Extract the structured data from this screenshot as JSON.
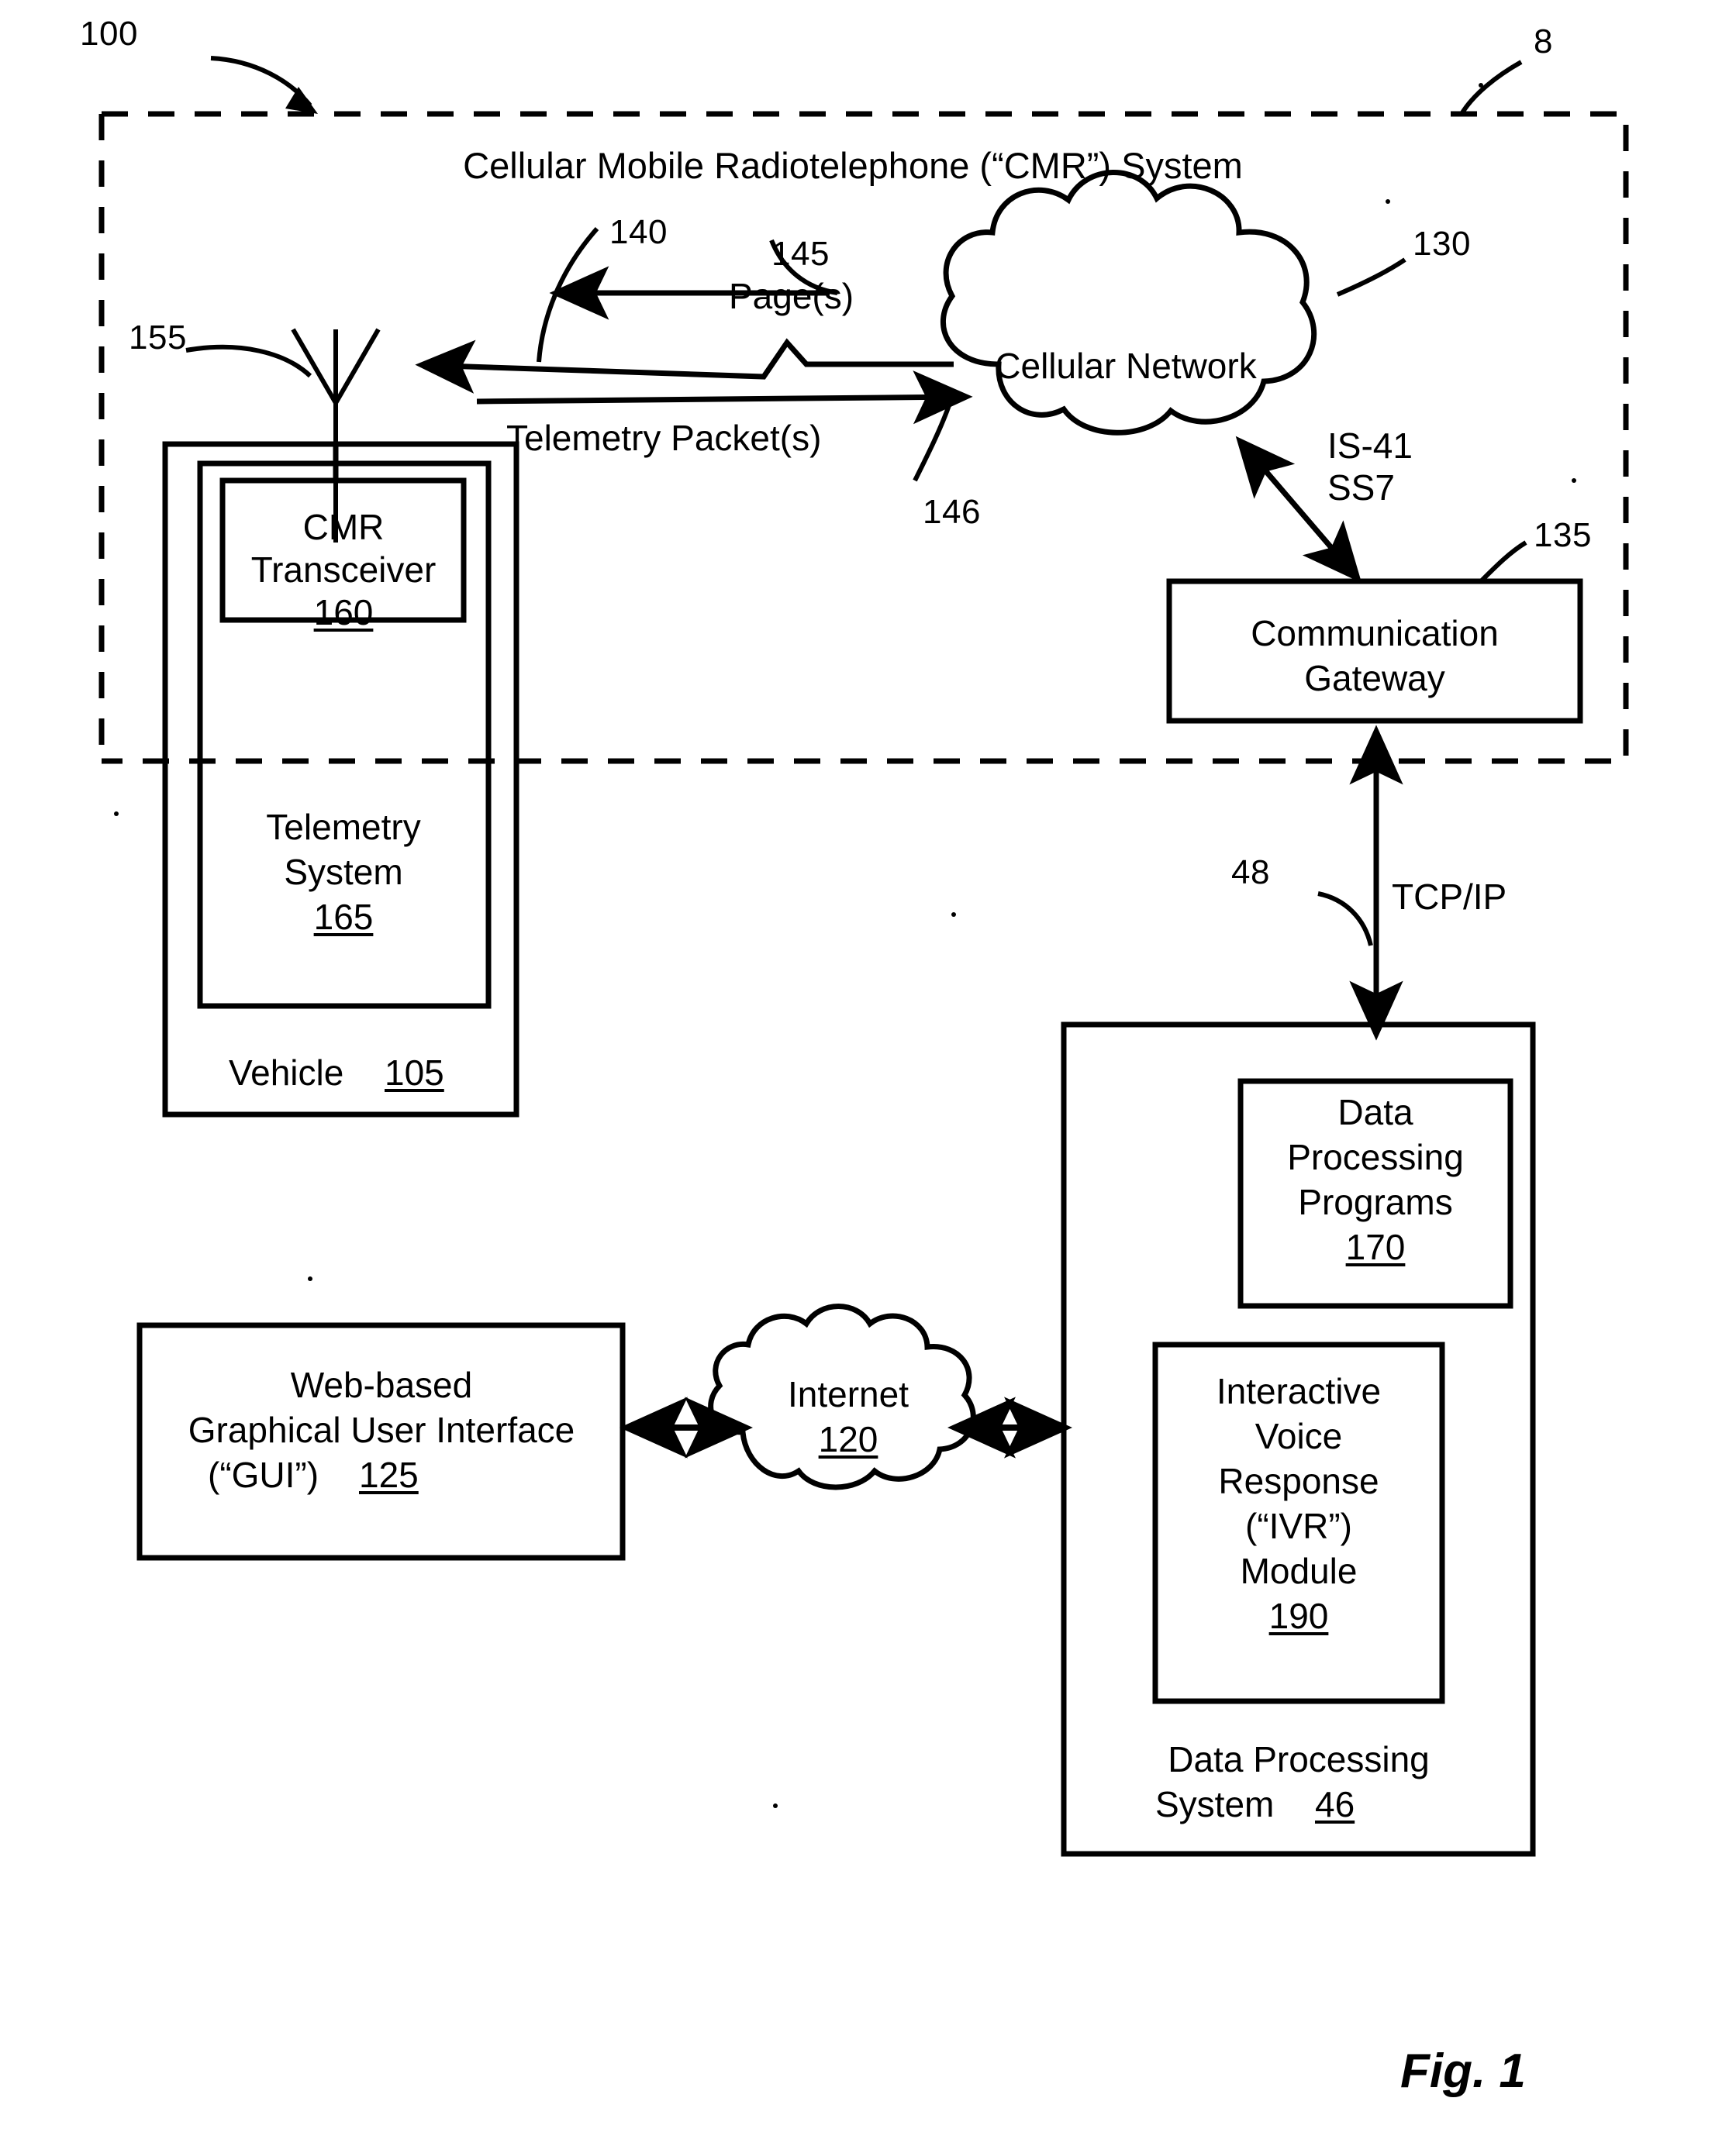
{
  "figure": {
    "caption": "Fig. 1",
    "system_reference": "100",
    "boundary_reference": "8"
  },
  "cmr_system": {
    "title": "Cellular Mobile Radiotelephone (“CMR”) System"
  },
  "nodes": {
    "vehicle": {
      "label": "Vehicle",
      "ref": "105"
    },
    "telemetry_system": {
      "label_line1": "Telemetry",
      "label_line2": "System",
      "ref": "165"
    },
    "cmr_transceiver": {
      "label_line1": "CMR",
      "label_line2": "Transceiver",
      "ref": "160"
    },
    "antenna": {
      "ref": "155"
    },
    "cellular_network": {
      "label": "Cellular Network",
      "ref": "130"
    },
    "communication_gateway": {
      "label_line1": "Communication",
      "label_line2": "Gateway",
      "ref": "135"
    },
    "data_processing_system": {
      "label_line1": "Data Processing",
      "label_line2": "System",
      "ref": "46"
    },
    "data_processing_programs": {
      "label_line1": "Data",
      "label_line2": "Processing",
      "label_line3": "Programs",
      "ref": "170"
    },
    "ivr_module": {
      "label_line1": "Interactive",
      "label_line2": "Voice",
      "label_line3": "Response",
      "label_line4": "(“IVR”)",
      "label_line5": "Module",
      "ref": "190"
    },
    "internet": {
      "label": "Internet",
      "ref": "120"
    },
    "web_gui": {
      "label_line1": "Web-based",
      "label_line2": "Graphical User Interface",
      "label_line3": "(“GUI”)",
      "ref": "125"
    }
  },
  "connections": {
    "downlink": {
      "ref": "140"
    },
    "pages": {
      "label": "Page(s)",
      "ref": "145"
    },
    "telemetry_packets": {
      "label": "Telemetry Packet(s)",
      "ref": "146"
    },
    "is41_ss7": {
      "label_line1": "IS-41",
      "label_line2": "SS7"
    },
    "tcpip": {
      "label": "TCP/IP",
      "ref": "48"
    }
  },
  "style": {
    "line_color": "#000000",
    "background": "#ffffff"
  }
}
